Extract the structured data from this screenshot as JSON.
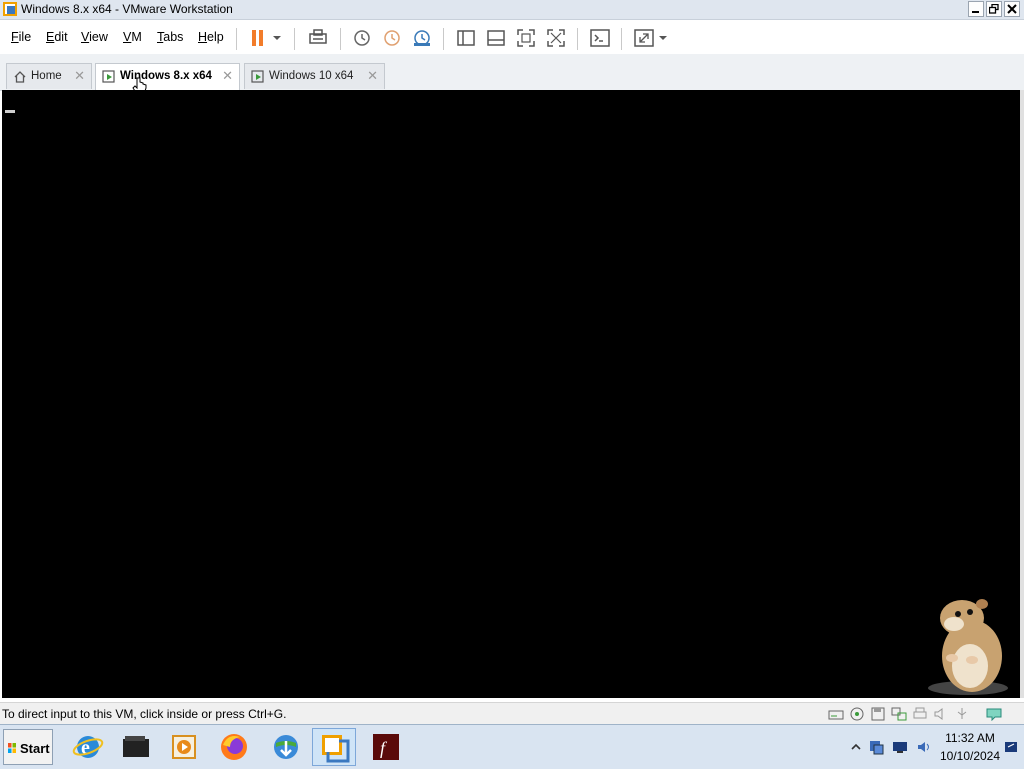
{
  "window": {
    "title": "Windows 8.x x64 - VMware Workstation"
  },
  "menu": [
    "File",
    "Edit",
    "View",
    "VM",
    "Tabs",
    "Help"
  ],
  "menu_underline": [
    "F",
    "E",
    "V",
    "V",
    "T",
    "H"
  ],
  "toolbar": {
    "icons": [
      "pause-icon",
      "dropdown-arrow-icon",
      "send-ctrl-alt-del-icon",
      "snapshot-icon",
      "revert-snapshot-icon",
      "snapshot-manager-icon",
      "library-view-icon",
      "thumbnail-bar-icon",
      "full-screen-icon",
      "unity-icon",
      "console-view-icon",
      "stretch-guest-icon",
      "stretch-dropdown-icon"
    ]
  },
  "tabs": [
    {
      "label": "Home",
      "icon": "home-icon",
      "active": false
    },
    {
      "label": "Windows 8.x x64",
      "icon": "vm-icon",
      "active": true
    },
    {
      "label": "Windows 10 x64",
      "icon": "vm-icon",
      "active": false
    }
  ],
  "tab_close_glyph": "✕",
  "status": {
    "message": "To direct input to this VM, click inside or press Ctrl+G.",
    "device_icons": [
      "hard-disk-icon",
      "cd-dvd-icon",
      "floppy-icon",
      "network-adapter-icon",
      "printer-icon",
      "sound-card-icon",
      "usb-icon",
      "message-log-icon"
    ]
  },
  "taskbar": {
    "start_label": "Start",
    "apps": [
      "internet-explorer-icon",
      "folder-icon",
      "media-player-icon",
      "firefox-icon",
      "internet-download-manager-icon",
      "vmware-workstation-icon",
      "adobe-flash-icon"
    ],
    "active_app": "vmware-workstation-icon",
    "tray_icons": [
      "show-hidden-icons-icon",
      "network-icon",
      "display-icon",
      "volume-icon",
      "action-center-icon"
    ],
    "clock_time": "11:32 AM",
    "clock_date": "10/10/2024"
  },
  "colors": {
    "accent_pause": "#f27c2a",
    "taskbar_bg": "#d9e4f1",
    "vm_bg": "#000000"
  }
}
